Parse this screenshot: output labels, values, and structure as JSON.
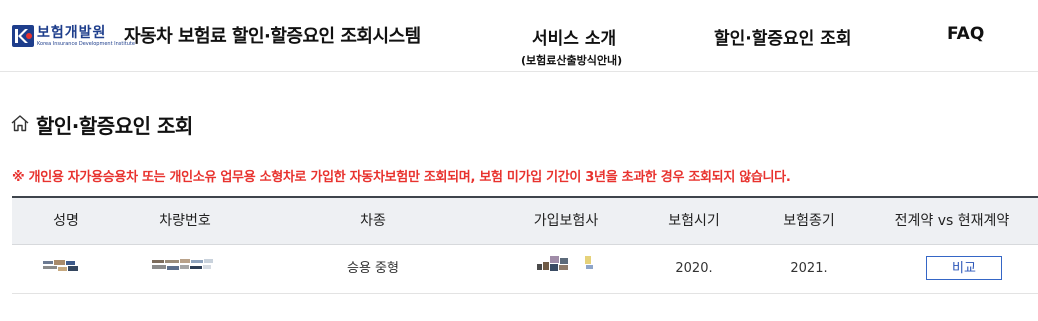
{
  "header": {
    "logo": {
      "org_korean": "보험개발원",
      "org_english": "Korea Insurance Development Institute",
      "icon": "kidi-logo-icon"
    },
    "site_title": "자동차 보험료 할인·할증요인 조회시스템",
    "nav": [
      {
        "label": "서비스 소개",
        "sub": "(보험료산출방식안내)"
      },
      {
        "label": "할인·할증요인 조회"
      },
      {
        "label": "FAQ"
      }
    ]
  },
  "page": {
    "icon": "home-icon",
    "title": "할인·할증요인 조회",
    "notice": "※ 개인용 자가용승용차 또는 개인소유 업무용 소형차로 가입한 자동차보험만 조회되며, 보험 미가입 기간이 3년을 초과한 경우 조회되지 않습니다."
  },
  "table": {
    "headers": [
      "성명",
      "차량번호",
      "차종",
      "가입보험사",
      "보험시기",
      "보험종기",
      "전계약 vs 현재계약"
    ],
    "rows": [
      {
        "name": "",
        "car_number": "",
        "car_type": "승용 중형",
        "insurer": "",
        "start": "2020.",
        "end": "2021.",
        "action": "비교"
      }
    ]
  },
  "colors": {
    "notice": "#e8322e",
    "brand": "#1e3e8c",
    "button": "#3566c6",
    "header_bg": "#eef0f3"
  }
}
